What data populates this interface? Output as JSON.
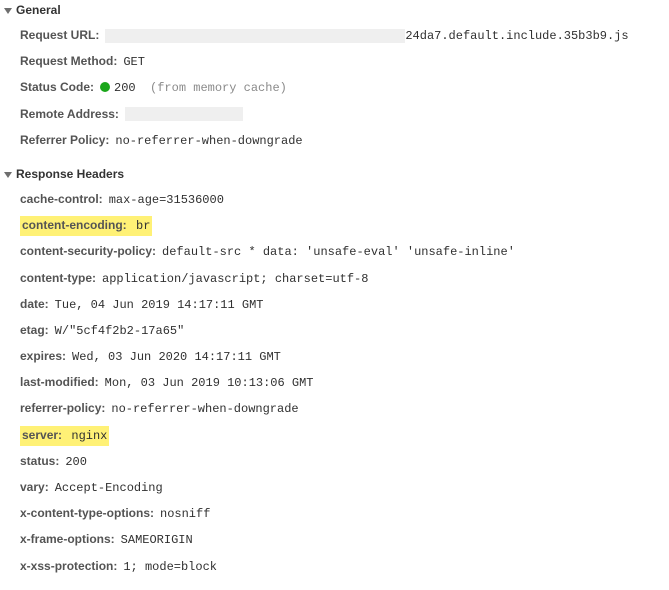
{
  "general": {
    "title": "General",
    "request_url": {
      "label": "Request URL:",
      "redacted_width": "wide",
      "suffix": "24da7.default.include.35b3b9.js"
    },
    "request_method": {
      "label": "Request Method:",
      "value": "GET"
    },
    "status_code": {
      "label": "Status Code:",
      "code": "200",
      "note": "(from memory cache)"
    },
    "remote_address": {
      "label": "Remote Address:",
      "redacted_width": "med"
    },
    "referrer_policy": {
      "label": "Referrer Policy:",
      "value": "no-referrer-when-downgrade"
    }
  },
  "response": {
    "title": "Response Headers",
    "headers": [
      {
        "key": "cache-control:",
        "value": "max-age=31536000",
        "highlight": false
      },
      {
        "key": "content-encoding:",
        "value": "br",
        "highlight": true
      },
      {
        "key": "content-security-policy:",
        "value": "default-src * data: 'unsafe-eval' 'unsafe-inline'",
        "highlight": false
      },
      {
        "key": "content-type:",
        "value": "application/javascript; charset=utf-8",
        "highlight": false
      },
      {
        "key": "date:",
        "value": "Tue, 04 Jun 2019 14:17:11 GMT",
        "highlight": false
      },
      {
        "key": "etag:",
        "value": "W/\"5cf4f2b2-17a65\"",
        "highlight": false
      },
      {
        "key": "expires:",
        "value": "Wed, 03 Jun 2020 14:17:11 GMT",
        "highlight": false
      },
      {
        "key": "last-modified:",
        "value": "Mon, 03 Jun 2019 10:13:06 GMT",
        "highlight": false
      },
      {
        "key": "referrer-policy:",
        "value": "no-referrer-when-downgrade",
        "highlight": false
      },
      {
        "key": "server:",
        "value": "nginx",
        "highlight": true
      },
      {
        "key": "status:",
        "value": "200",
        "highlight": false
      },
      {
        "key": "vary:",
        "value": "Accept-Encoding",
        "highlight": false
      },
      {
        "key": "x-content-type-options:",
        "value": "nosniff",
        "highlight": false
      },
      {
        "key": "x-frame-options:",
        "value": "SAMEORIGIN",
        "highlight": false
      },
      {
        "key": "x-xss-protection:",
        "value": "1; mode=block",
        "highlight": false
      }
    ]
  }
}
